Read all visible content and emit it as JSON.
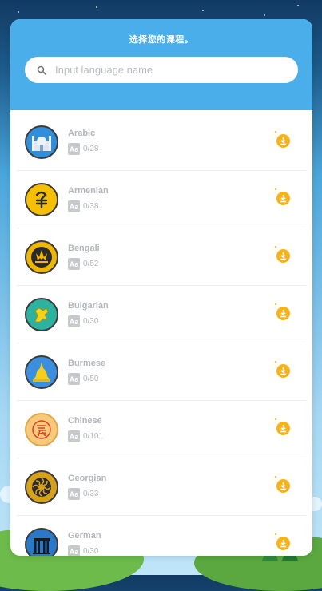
{
  "header": {
    "title": "选择您的课程。"
  },
  "search": {
    "placeholder": "Input language name"
  },
  "languages": [
    {
      "name": "Arabic",
      "progress": "0/28",
      "icon": "mosque-icon",
      "color": "#2f8fdc"
    },
    {
      "name": "Armenian",
      "progress": "0/38",
      "icon": "dram-symbol-icon",
      "color": "#f6c000"
    },
    {
      "name": "Bengali",
      "progress": "0/52",
      "icon": "lotus-icon",
      "color": "#f1b700"
    },
    {
      "name": "Bulgarian",
      "progress": "0/30",
      "icon": "lion-icon",
      "color": "#2bb3a0"
    },
    {
      "name": "Burmese",
      "progress": "0/50",
      "icon": "pagoda-icon",
      "color": "#3a8fe0"
    },
    {
      "name": "Chinese",
      "progress": "0/101",
      "icon": "love-character-icon",
      "color": "#f7c97a"
    },
    {
      "name": "Georgian",
      "progress": "0/33",
      "icon": "borjgali-icon",
      "color": "#d7a21a"
    },
    {
      "name": "German",
      "progress": "0/30",
      "icon": "brandenburg-gate-icon",
      "color": "#2a78c8"
    }
  ],
  "labels": {
    "aa": "Aa"
  },
  "colors": {
    "header": "#4aaeea",
    "download": "#f6b417",
    "muted_text": "#b3b6ba"
  }
}
